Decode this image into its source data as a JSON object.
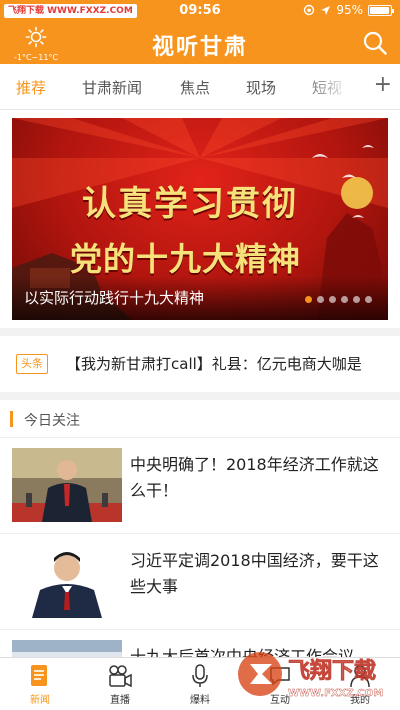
{
  "status_bar": {
    "watermark_site": "飞翔下载 WWW.FXXZ.COM",
    "time": "09:56",
    "battery": "95%",
    "battery_level": 0.95
  },
  "header": {
    "title": "视听甘肃",
    "weather_temp": "-1°C~11°C",
    "weather_icon": "sun-icon",
    "search_icon": "search-icon"
  },
  "tabs": {
    "items": [
      {
        "label": "推荐",
        "active": true
      },
      {
        "label": "甘肃新闻",
        "active": false
      },
      {
        "label": "焦点",
        "active": false
      },
      {
        "label": "现场",
        "active": false
      },
      {
        "label": "短视",
        "active": false
      }
    ],
    "more_icon": "plus-icon"
  },
  "banner": {
    "line1": "认真学习贯彻",
    "line2": "党的十九大精神",
    "caption": "以实际行动践行十九大精神",
    "slide_count": 6,
    "active_slide": 1
  },
  "headline": {
    "badge": "头条",
    "text": "【我为新甘肃打call】礼县：亿元电商大咖是"
  },
  "section": {
    "title": "今日关注"
  },
  "news": [
    {
      "title": "中央明确了！2018年经济工作就这么干！"
    },
    {
      "title": "习近平定调2018中国经济，要干这些大事"
    },
    {
      "title": "十九大后首次中央经济工作会议"
    }
  ],
  "bottom_nav": [
    {
      "label": "新闻",
      "icon": "news-icon",
      "active": true
    },
    {
      "label": "直播",
      "icon": "video-camera-icon",
      "active": false
    },
    {
      "label": "爆料",
      "icon": "microphone-icon",
      "active": false
    },
    {
      "label": "互动",
      "icon": "chat-icon",
      "active": false
    },
    {
      "label": "我的",
      "icon": "user-icon",
      "active": false
    }
  ],
  "watermark": {
    "title": "飞翔下载",
    "url": "WWW.FXXZ.COM"
  },
  "colors": {
    "brand_orange": "#f7941d",
    "banner_red": "#c81a12",
    "banner_text": "#f6e27a"
  }
}
